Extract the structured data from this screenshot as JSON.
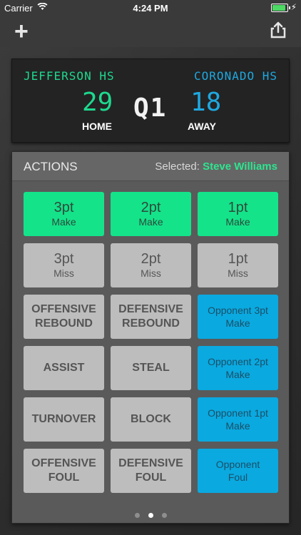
{
  "status": {
    "carrier": "Carrier",
    "time": "4:24 PM",
    "battery_level": 0.9
  },
  "icons": {
    "wifi": "wifi-icon",
    "add": "plus-icon",
    "share": "share-icon",
    "bolt": "charging-icon"
  },
  "scoreboard": {
    "home_team": "JEFFERSON HS",
    "away_team": "CORONADO HS",
    "home_score": "29",
    "away_score": "18",
    "quarter": "Q1",
    "home_label": "HOME",
    "away_label": "AWAY",
    "colors": {
      "home": "#1ed98e",
      "away": "#1ea8e0"
    }
  },
  "actions": {
    "title": "ACTIONS",
    "selected_label": "Selected:",
    "selected_player": "Steve Williams",
    "buttons": [
      {
        "line1": "3pt",
        "line2": "Make",
        "style": "green"
      },
      {
        "line1": "2pt",
        "line2": "Make",
        "style": "green"
      },
      {
        "line1": "1pt",
        "line2": "Make",
        "style": "green"
      },
      {
        "line1": "3pt",
        "line2": "Miss",
        "style": "gray"
      },
      {
        "line1": "2pt",
        "line2": "Miss",
        "style": "gray"
      },
      {
        "line1": "1pt",
        "line2": "Miss",
        "style": "gray"
      },
      {
        "line1": "OFFENSIVE",
        "line2": "REBOUND",
        "style": "gray-caps"
      },
      {
        "line1": "DEFENSIVE",
        "line2": "REBOUND",
        "style": "gray-caps"
      },
      {
        "line1": "Opponent 3pt",
        "line2": "Make",
        "style": "blue"
      },
      {
        "line1": "ASSIST",
        "line2": "",
        "style": "gray-caps"
      },
      {
        "line1": "STEAL",
        "line2": "",
        "style": "gray-caps"
      },
      {
        "line1": "Opponent 2pt",
        "line2": "Make",
        "style": "blue"
      },
      {
        "line1": "TURNOVER",
        "line2": "",
        "style": "gray-caps"
      },
      {
        "line1": "BLOCK",
        "line2": "",
        "style": "gray-caps"
      },
      {
        "line1": "Opponent 1pt",
        "line2": "Make",
        "style": "blue"
      },
      {
        "line1": "OFFENSIVE",
        "line2": "FOUL",
        "style": "gray-caps"
      },
      {
        "line1": "DEFENSIVE",
        "line2": "FOUL",
        "style": "gray-caps"
      },
      {
        "line1": "Opponent",
        "line2": "Foul",
        "style": "blue"
      }
    ],
    "pages": {
      "count": 3,
      "current": 2
    }
  },
  "colors": {
    "accent_green": "#14e38a",
    "accent_blue": "#0aa9e0",
    "button_gray": "#bdbdbd"
  }
}
